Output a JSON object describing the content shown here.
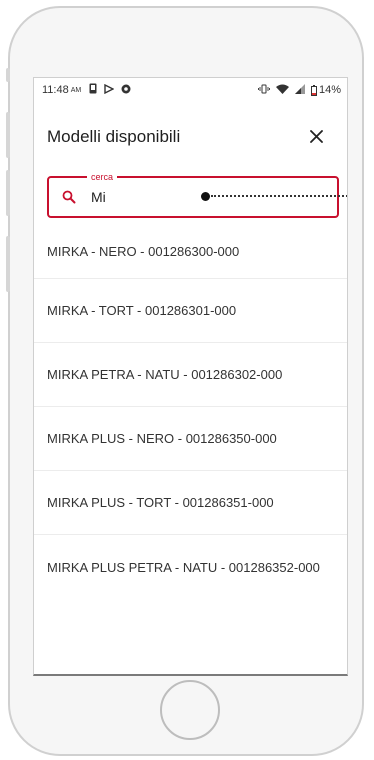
{
  "status_bar": {
    "time": "11:48",
    "ampm": "AM",
    "battery": "14%",
    "icons": [
      "notification-icon",
      "play-store-icon",
      "chrome-icon",
      "vibrate-icon",
      "wifi-icon",
      "signal-icon",
      "battery-icon"
    ]
  },
  "dialog": {
    "title": "Modelli disponibili",
    "close_icon": "close-icon"
  },
  "search": {
    "label": "cerca",
    "value": "Mi",
    "icon": "search-icon"
  },
  "models": [
    "MIRKA - NERO - 001286300-000",
    "MIRKA - TORT - 001286301-000",
    "MIRKA PETRA - NATU - 001286302-000",
    "MIRKA PLUS - NERO - 001286350-000",
    "MIRKA PLUS - TORT - 001286351-000",
    "MIRKA PLUS PETRA - NATU - 001286352-000"
  ],
  "colors": {
    "accent": "#c8102e",
    "text": "#333333"
  }
}
